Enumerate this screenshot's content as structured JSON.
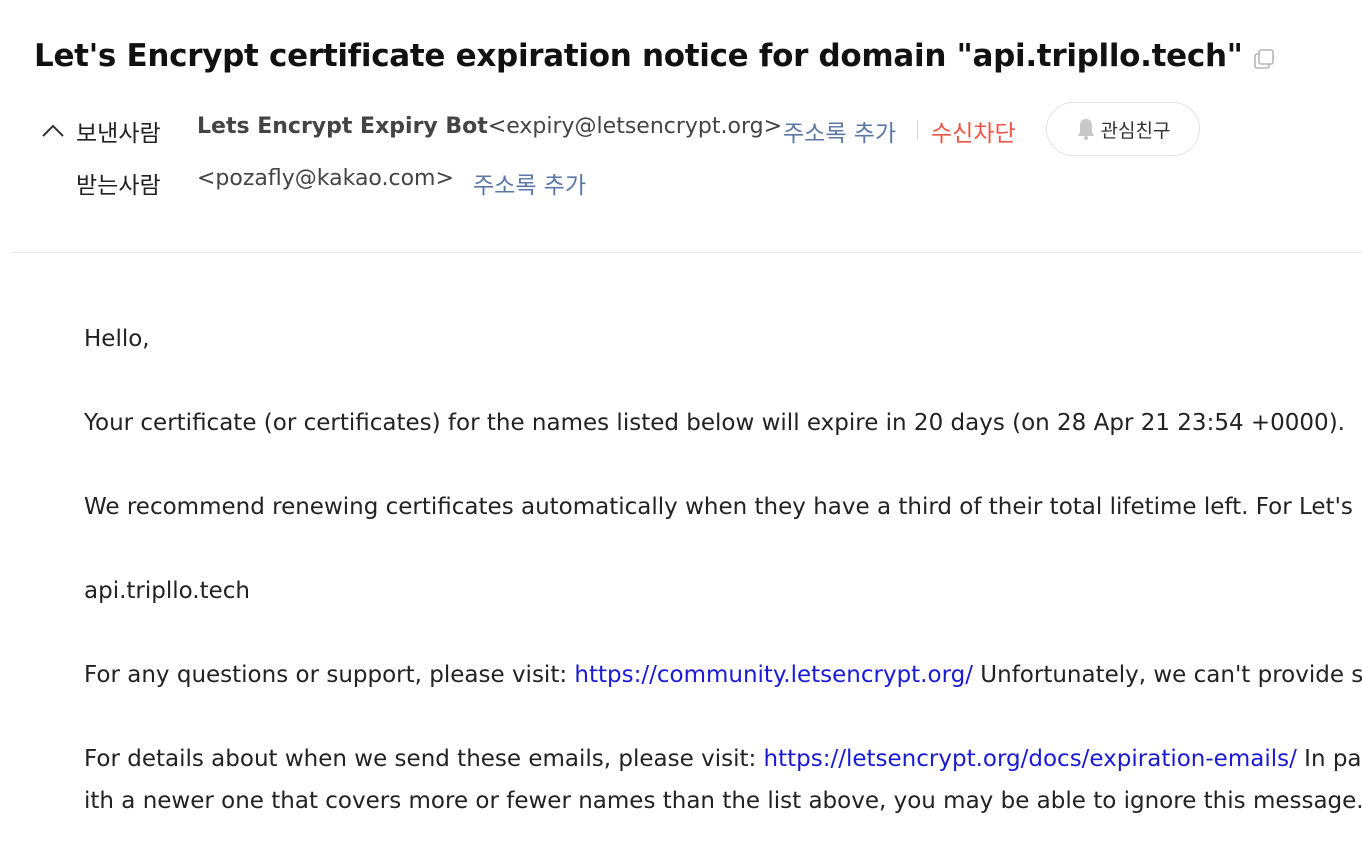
{
  "email": {
    "subject": "Let's Encrypt certificate expiration notice for domain \"api.tripllo.tech\"",
    "from": {
      "label": "보낸사람",
      "name": "Lets Encrypt Expiry Bot",
      "address": "<expiry@letsencrypt.org>",
      "add_contact": "주소록 추가",
      "block": "수신차단",
      "favorite": "관심친구"
    },
    "to": {
      "label": "받는사람",
      "address": "<pozafly@kakao.com>",
      "add_contact": "주소록 추가"
    },
    "icons": {
      "copy": "copy-icon",
      "toggle": "chevron-up-icon",
      "bell": "bell-icon"
    },
    "colors": {
      "link": "#1a1ad4",
      "contact_link": "#5b77a6",
      "block": "#ee5544"
    }
  },
  "body": {
    "greeting": "Hello,",
    "line1": "Your certificate (or certificates) for the names listed below will expire in 20 days (on 28 Apr 21 23:54 +0000). ",
    "line2": "We recommend renewing certificates automatically when they have a third of their total lifetime left. For Let's",
    "domain": "api.tripllo.tech",
    "line4_prefix": "For any questions or support, please visit: ",
    "line4_link": "https://community.letsencrypt.org/",
    "line4_suffix": " Unfortunately, we can't provide s",
    "line5_prefix": "For details about when we send these emails, please visit: ",
    "line5_link": "https://letsencrypt.org/docs/expiration-emails/",
    "line5_suffix": " In pa",
    "line6": "ith a newer one that covers more or fewer names than the list above, you may be able to ignore this message."
  }
}
